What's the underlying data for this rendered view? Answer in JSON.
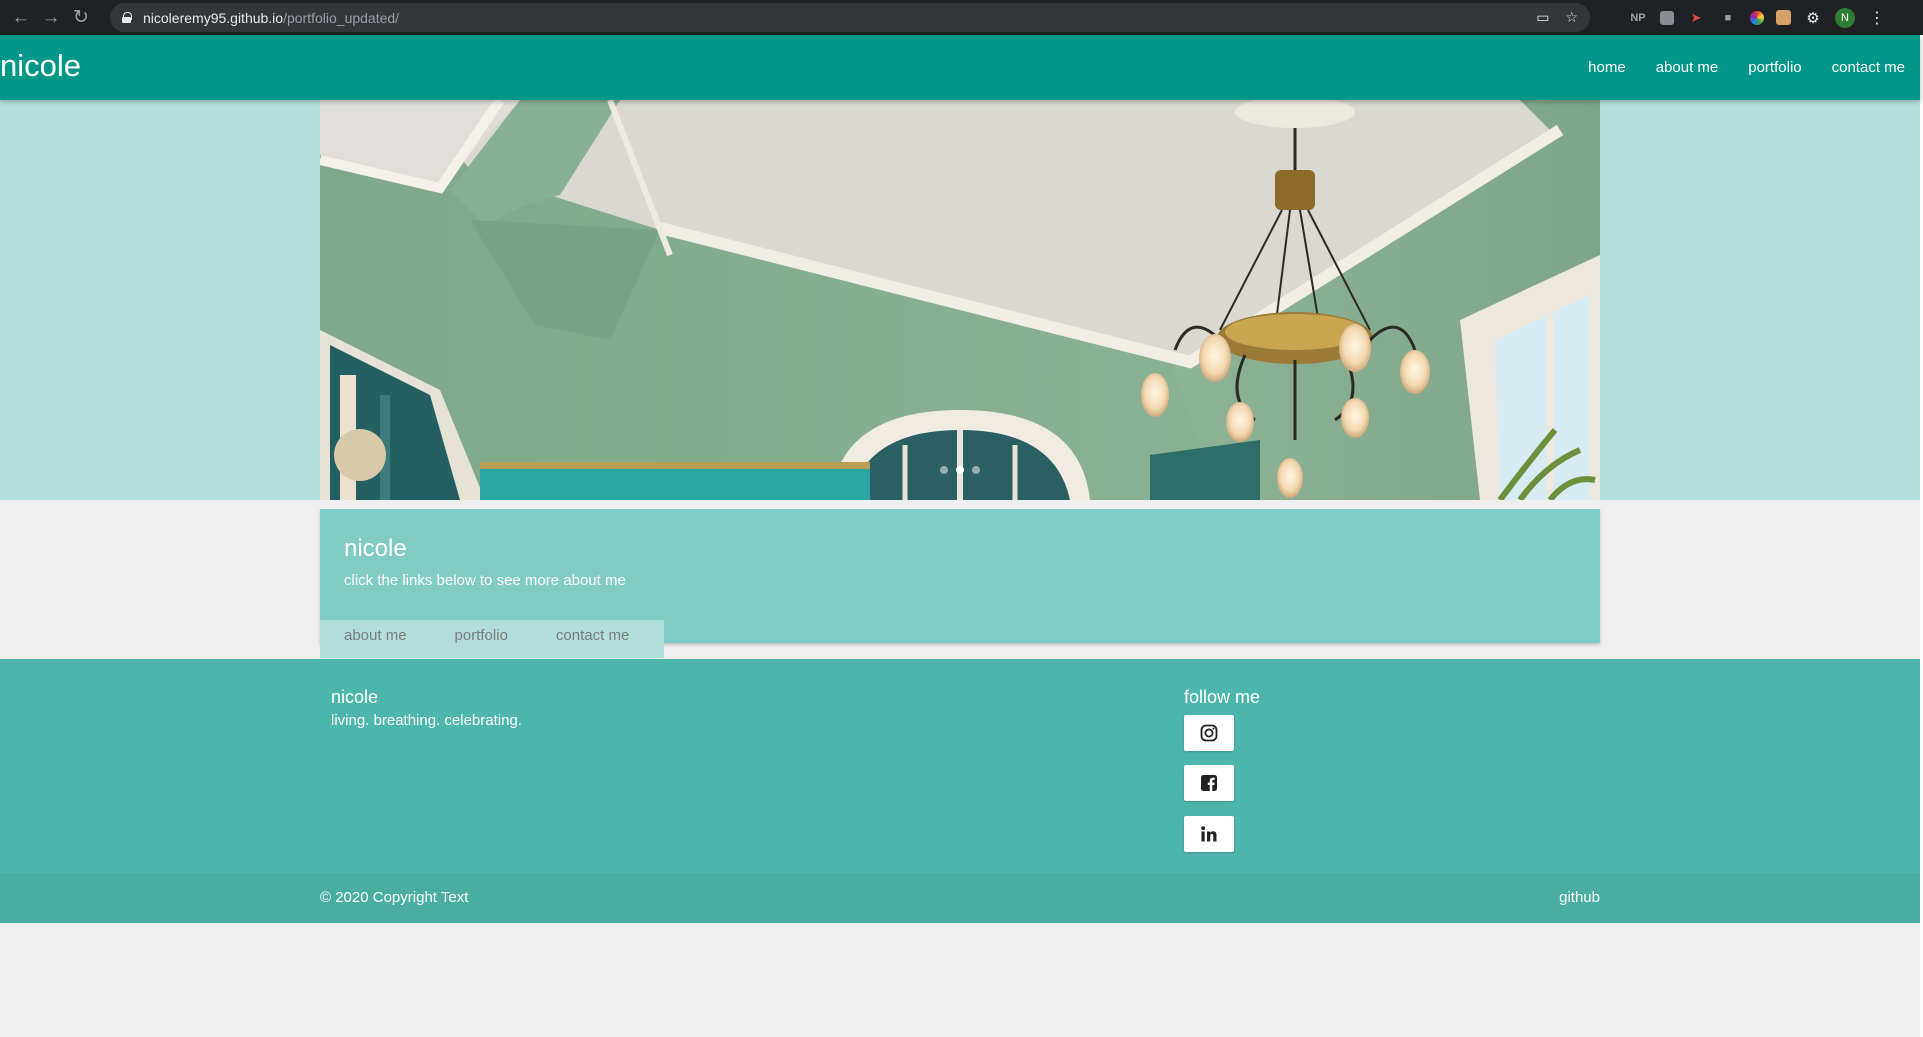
{
  "browser": {
    "url_host": "nicoleremy95.github.io",
    "url_path": "/portfolio_updated/",
    "profile_initial": "N",
    "extension_np": "NP"
  },
  "nav": {
    "brand": "nicole",
    "links": [
      "home",
      "about me",
      "portfolio",
      "contact me"
    ]
  },
  "hero": {
    "slides": 3,
    "active_slide": 2
  },
  "card": {
    "title": "nicole",
    "subtitle": "click the links below to see more about me",
    "tabs": [
      "about me",
      "portfolio",
      "contact me"
    ]
  },
  "footer": {
    "title": "nicole",
    "tagline": "living. breathing. celebrating.",
    "follow_title": "follow me",
    "social": [
      "instagram-icon",
      "facebook-icon",
      "linkedin-icon"
    ],
    "copyright": "© 2020 Copyright Text",
    "github": "github"
  },
  "colors": {
    "nav": "#009688",
    "hero_band": "#b2dfdb",
    "card": "#80cbc4",
    "footer": "#4db6ac",
    "bottom_bar": "#4aada2"
  }
}
